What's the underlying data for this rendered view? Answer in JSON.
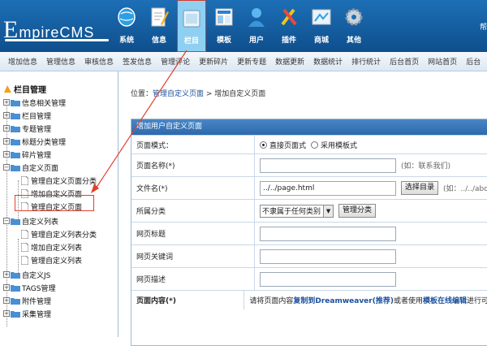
{
  "colors": {
    "header": "#1d6fb6",
    "accent": "#d73a2a",
    "link": "#1b4f9c"
  },
  "logo": {
    "first_letter": "E",
    "rest": "mpireCMS"
  },
  "topnav": [
    {
      "label": "系统",
      "icon": "globe-icon"
    },
    {
      "label": "信息",
      "icon": "pencil-icon"
    },
    {
      "label": "栏目",
      "icon": "folder-icon"
    },
    {
      "label": "模板",
      "icon": "template-icon"
    },
    {
      "label": "用户",
      "icon": "user-icon"
    },
    {
      "label": "插件",
      "icon": "tools-icon"
    },
    {
      "label": "商城",
      "icon": "shop-icon"
    },
    {
      "label": "其他",
      "icon": "gear-icon"
    }
  ],
  "header_right": "帮",
  "subnav": [
    "增加信息",
    "管理信息",
    "审核信息",
    "签发信息",
    "管理评论",
    "更新碎片",
    "更新专题",
    "数据更新",
    "数据统计",
    "排行统计",
    "后台首页",
    "网站首页",
    "后台"
  ],
  "sidebar": {
    "root": "栏目管理",
    "items": [
      "信息相关管理",
      "栏目管理",
      "专题管理",
      "标题分类管理",
      "碎片管理",
      "自定义页面",
      "管理自定义页面分类",
      "增加自定义页面",
      "管理自定义页面",
      "自定义列表",
      "管理自定义列表分类",
      "增加自定义列表",
      "管理自定义列表",
      "自定义JS",
      "TAGS管理",
      "附件管理",
      "采集管理"
    ]
  },
  "breadcrumb": {
    "prefix": "位置：",
    "link": "管理自定义页面",
    "sep": " > ",
    "current": "增加自定义页面"
  },
  "form": {
    "title": "增加用户自定义页面",
    "mode_label": "页面模式：",
    "mode_option1": "直接页面式",
    "mode_option2": "采用模板式",
    "name_label": "页面名称(*)",
    "name_value": "",
    "name_hint": "(如：联系我们)",
    "file_label": "文件名(*)",
    "file_value": "../../page.html",
    "file_button": "选择目录",
    "file_hint": "(如：../../abo",
    "category_label": "所属分类",
    "category_value": "不隶属于任何类别",
    "category_button": "管理分类",
    "seo_title_label": "网页标题",
    "seo_title_value": "",
    "keywords_label": "网页关键词",
    "keywords_value": "",
    "desc_label": "网页描述",
    "desc_value": "",
    "content_label": "页面内容(*)",
    "content_note_1": "请将页面内容",
    "content_note_link1": "复制到Dreamweaver(推荐)",
    "content_note_2": "或者使用",
    "content_note_link2": "模板在线编辑",
    "content_note_3": "进行可"
  }
}
